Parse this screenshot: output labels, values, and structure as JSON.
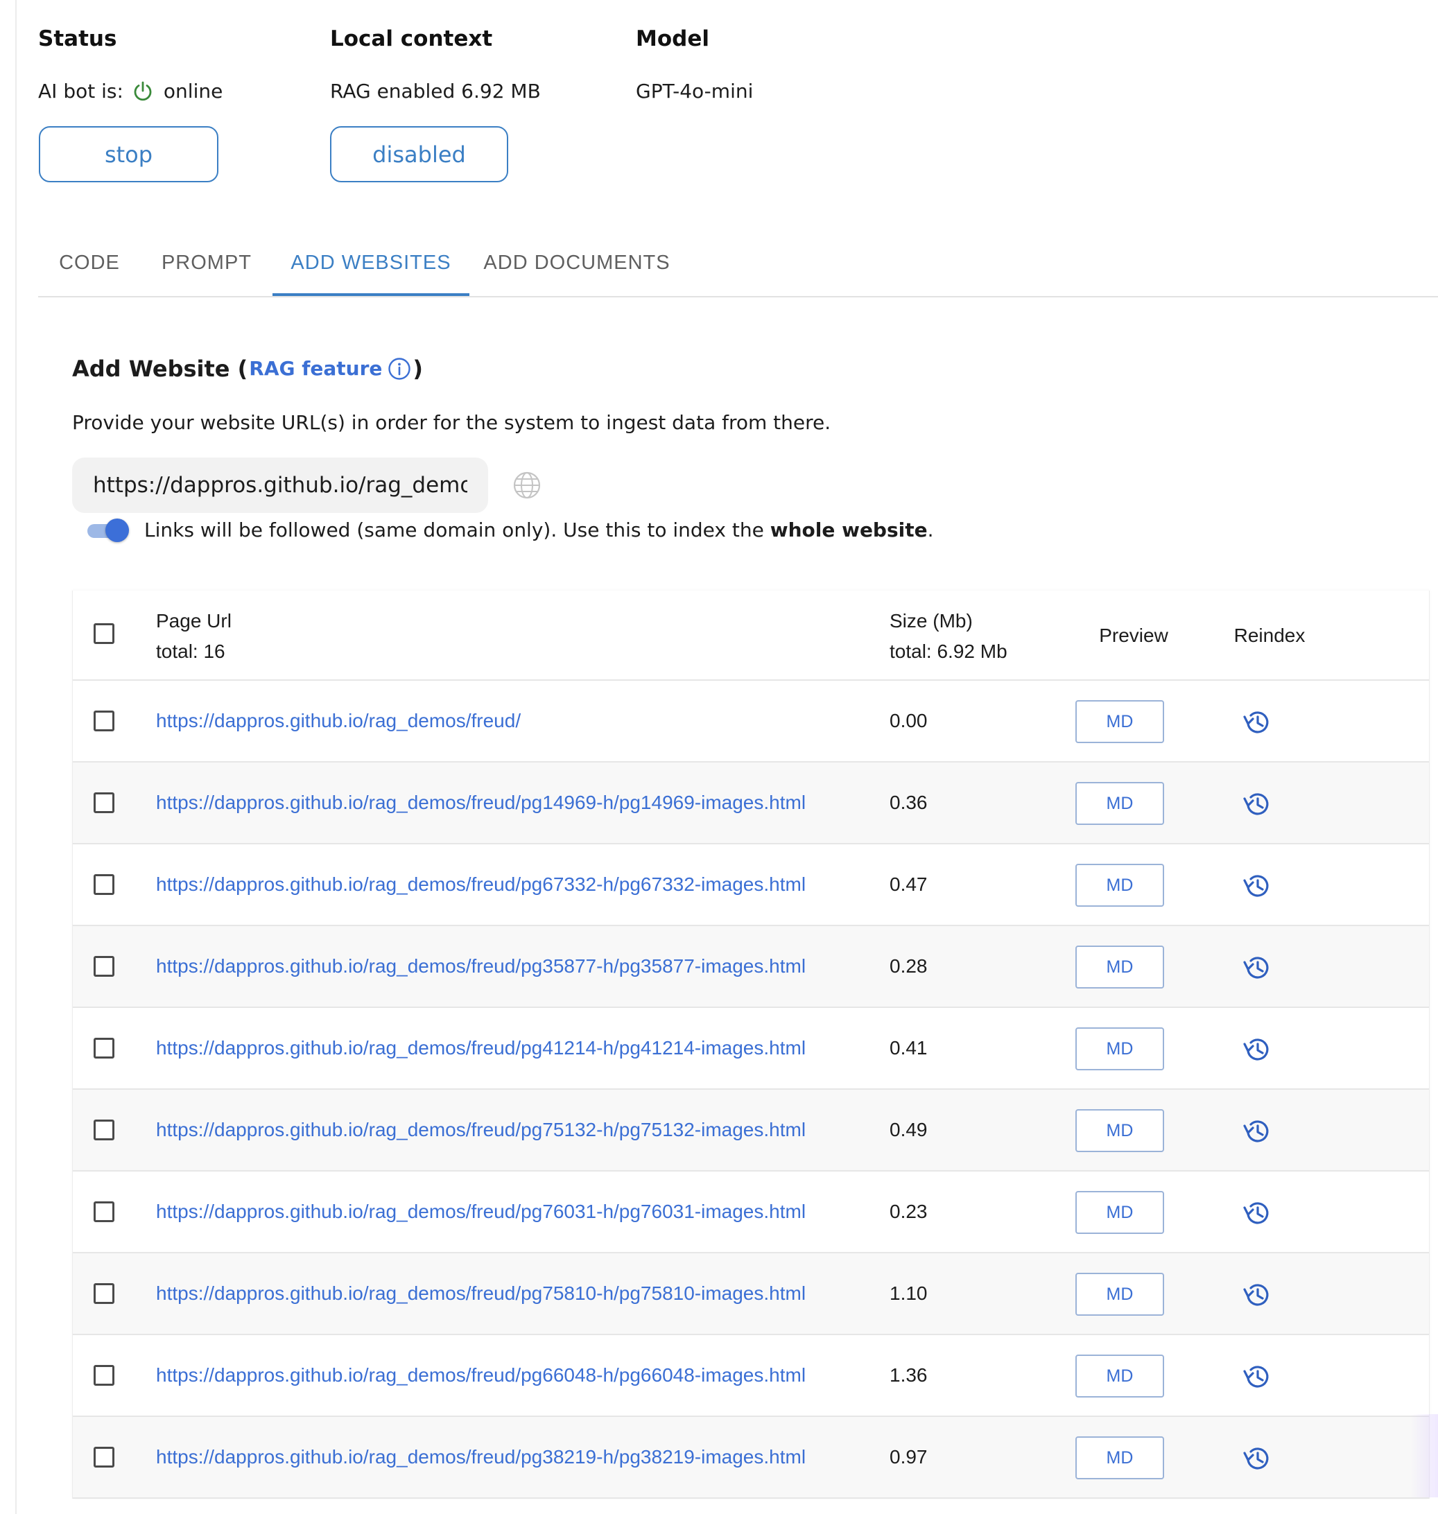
{
  "status": {
    "title": "Status",
    "ai_bot_label": "AI bot is:",
    "ai_bot_state": "online",
    "stop_button": "stop"
  },
  "local_context": {
    "title": "Local context",
    "value": "RAG enabled 6.92 MB",
    "button": "disabled"
  },
  "model": {
    "title": "Model",
    "value": "GPT-4o-mini"
  },
  "tabs": [
    {
      "label": "CODE",
      "active": false
    },
    {
      "label": "PROMPT",
      "active": false
    },
    {
      "label": "ADD WEBSITES",
      "active": true
    },
    {
      "label": "ADD DOCUMENTS",
      "active": false
    }
  ],
  "add_website": {
    "title": "Add Website (",
    "rag_link": "RAG feature",
    "title_close": ")",
    "description": "Provide your website URL(s) in order for the system to ingest data from there.",
    "url_value": "https://dappros.github.io/rag_demos/freud/",
    "toggle_on": true,
    "toggle_text": "Links will be followed (same domain only). Use this to index the ",
    "toggle_text_bold": "whole website",
    "toggle_text_end": "."
  },
  "table": {
    "headers": {
      "page_url": "Page Url",
      "total_pages": "total: 16",
      "size": "Size (Mb)",
      "total_size": "total: 6.92 Mb",
      "preview": "Preview",
      "reindex": "Reindex"
    },
    "preview_label": "MD",
    "rows": [
      {
        "url": "https://dappros.github.io/rag_demos/freud/",
        "size": "0.00"
      },
      {
        "url": "https://dappros.github.io/rag_demos/freud/pg14969-h/pg14969-images.html",
        "size": "0.36"
      },
      {
        "url": "https://dappros.github.io/rag_demos/freud/pg67332-h/pg67332-images.html",
        "size": "0.47"
      },
      {
        "url": "https://dappros.github.io/rag_demos/freud/pg35877-h/pg35877-images.html",
        "size": "0.28"
      },
      {
        "url": "https://dappros.github.io/rag_demos/freud/pg41214-h/pg41214-images.html",
        "size": "0.41"
      },
      {
        "url": "https://dappros.github.io/rag_demos/freud/pg75132-h/pg75132-images.html",
        "size": "0.49"
      },
      {
        "url": "https://dappros.github.io/rag_demos/freud/pg76031-h/pg76031-images.html",
        "size": "0.23"
      },
      {
        "url": "https://dappros.github.io/rag_demos/freud/pg75810-h/pg75810-images.html",
        "size": "1.10"
      },
      {
        "url": "https://dappros.github.io/rag_demos/freud/pg66048-h/pg66048-images.html",
        "size": "1.36"
      },
      {
        "url": "https://dappros.github.io/rag_demos/freud/pg38219-h/pg38219-images.html",
        "size": "0.97"
      }
    ]
  },
  "colors": {
    "accent": "#3b7fc4",
    "link": "#3b6fd4",
    "online": "#3a8a3a"
  },
  "icons": [
    "power-icon",
    "info-icon",
    "globe-icon",
    "reindex-history-icon"
  ]
}
